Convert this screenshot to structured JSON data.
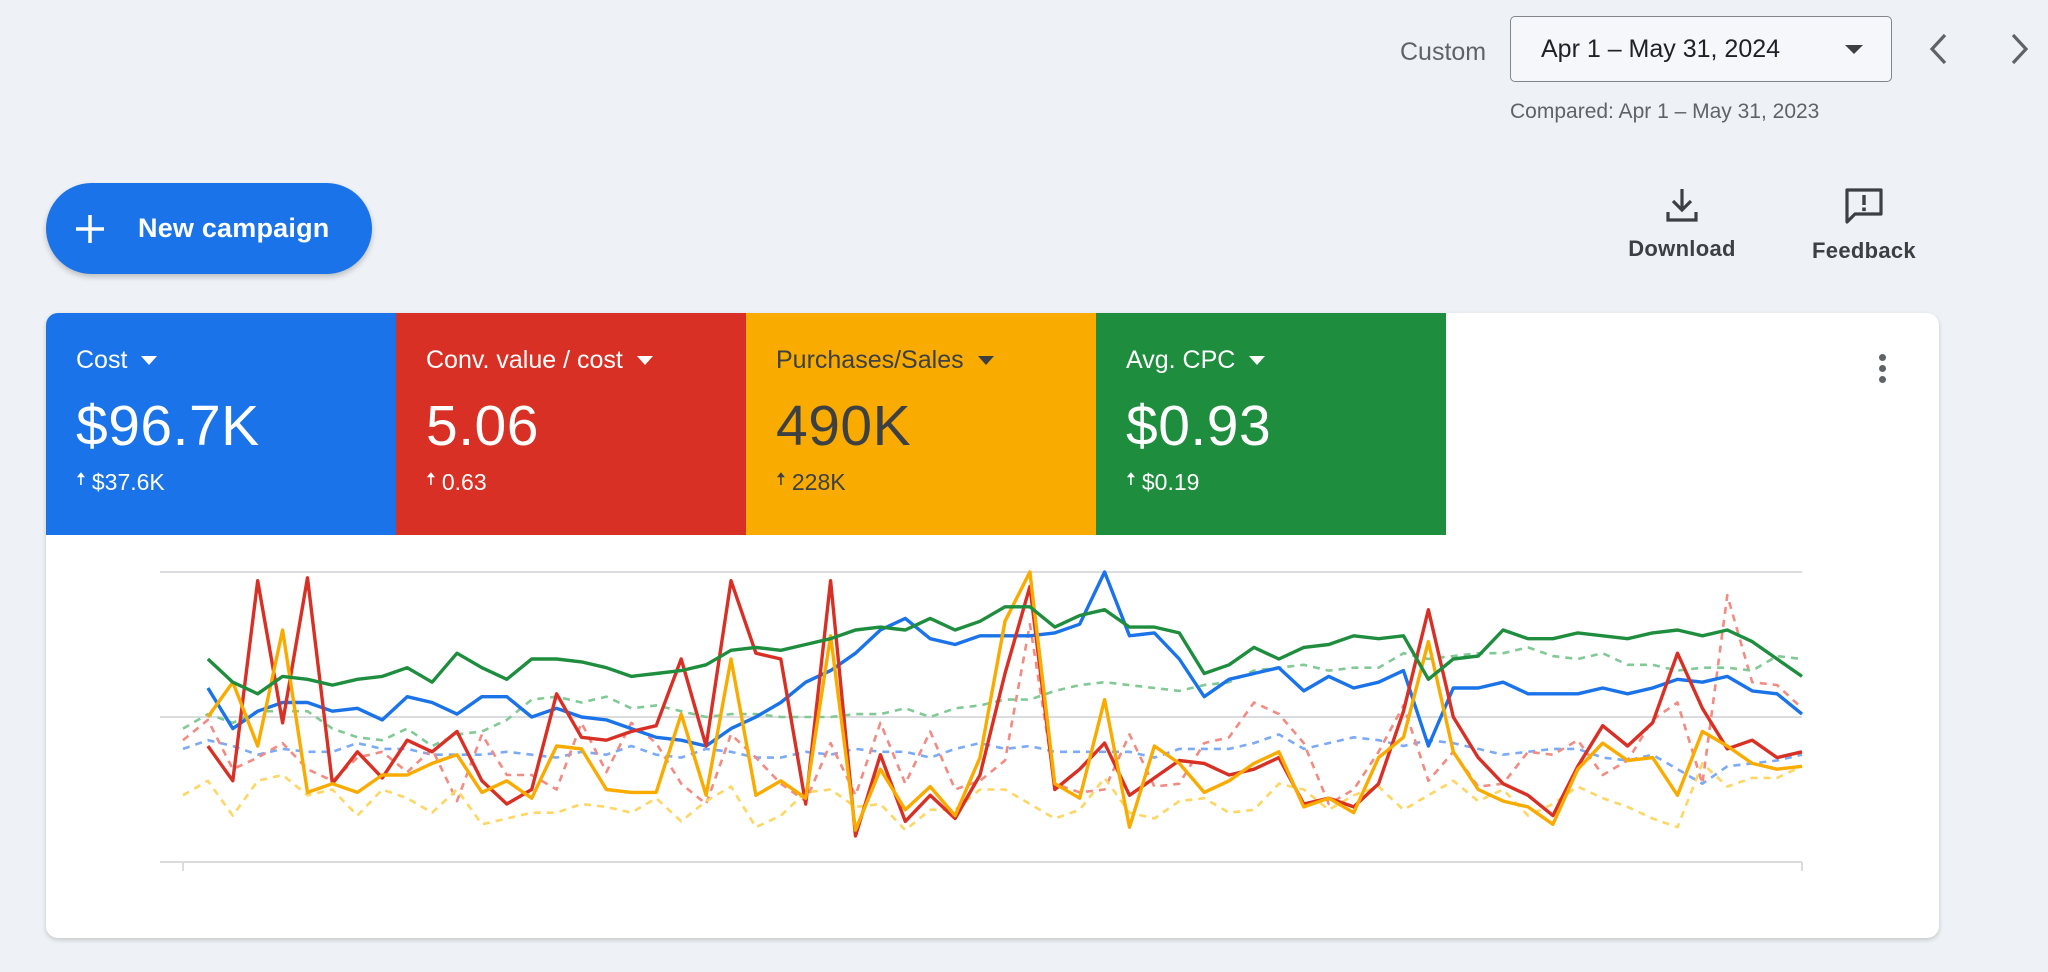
{
  "header": {
    "range_label": "Custom",
    "date_range": "Apr 1 – May 31, 2024",
    "compared": "Compared: Apr 1 – May 31, 2023"
  },
  "actions": {
    "new_campaign": "New campaign",
    "download": "Download",
    "feedback": "Feedback"
  },
  "metrics": [
    {
      "label": "Cost",
      "value": "$96.7K",
      "delta": "$37.6K",
      "color": "#1a73e8"
    },
    {
      "label": "Conv. value / cost",
      "value": "5.06",
      "delta": "0.63",
      "color": "#d93025"
    },
    {
      "label": "Purchases/Sales",
      "value": "490K",
      "delta": "228K",
      "color": "#f9ab00"
    },
    {
      "label": "Avg. CPC",
      "value": "$0.93",
      "delta": "$0.19",
      "color": "#1e8e3e"
    }
  ],
  "chart_data": {
    "type": "line",
    "x": "Apr 1 – May 31",
    "y_scale": "normalized per series (0 = bottom gridline, 100 = top gridline)",
    "series": [
      {
        "name": "Cost",
        "color": "#1a73e8",
        "style": "solid",
        "values": [
          48,
          60,
          46,
          52,
          55,
          55,
          52,
          53,
          49,
          57,
          55,
          51,
          57,
          57,
          50,
          53,
          50,
          49,
          46,
          43,
          42,
          40,
          46,
          50,
          55,
          62,
          66,
          72,
          80,
          84,
          77,
          75,
          78,
          78,
          78,
          79,
          82,
          100,
          78,
          79,
          70,
          57,
          63,
          65,
          67,
          59,
          64,
          60,
          62,
          66,
          40,
          60,
          60,
          62,
          58,
          58,
          58,
          60,
          58,
          60,
          63,
          62,
          64,
          59,
          58,
          51
        ]
      },
      {
        "name": "Conv. value / cost",
        "color": "#d93025",
        "style": "solid",
        "values": [
          27,
          40,
          28,
          97,
          48,
          98,
          27,
          38,
          29,
          42,
          38,
          45,
          28,
          20,
          25,
          58,
          43,
          42,
          45,
          47,
          70,
          40,
          97,
          72,
          70,
          20,
          97,
          9,
          37,
          14,
          23,
          15,
          30,
          65,
          95,
          25,
          32,
          41,
          23,
          29,
          35,
          34,
          30,
          32,
          36,
          20,
          22,
          19,
          27,
          52,
          87,
          50,
          36,
          27,
          23,
          16,
          33,
          47,
          40,
          48,
          72,
          53,
          39,
          42,
          36,
          38
        ]
      },
      {
        "name": "Purchases/Sales",
        "color": "#f9ab00",
        "style": "solid",
        "values": [
          28,
          50,
          62,
          40,
          80,
          24,
          27,
          24,
          30,
          30,
          34,
          37,
          24,
          28,
          22,
          40,
          39,
          25,
          24,
          24,
          51,
          23,
          70,
          23,
          28,
          22,
          78,
          11,
          32,
          18,
          26,
          16,
          36,
          83,
          100,
          27,
          22,
          56,
          12,
          40,
          34,
          24,
          28,
          34,
          38,
          19,
          22,
          17,
          36,
          43,
          76,
          38,
          25,
          21,
          19,
          13,
          32,
          41,
          35,
          36,
          23,
          45,
          40,
          34,
          32,
          33
        ]
      },
      {
        "name": "Avg. CPC",
        "color": "#1e8e3e",
        "style": "solid",
        "values": [
          64,
          70,
          62,
          58,
          64,
          63,
          61,
          63,
          64,
          67,
          62,
          72,
          67,
          63,
          70,
          70,
          69,
          67,
          64,
          65,
          66,
          68,
          73,
          74,
          73,
          75,
          77,
          80,
          81,
          80,
          84,
          80,
          83,
          88,
          88,
          81,
          85,
          87,
          81,
          81,
          79,
          65,
          68,
          74,
          70,
          74,
          75,
          78,
          77,
          78,
          63,
          70,
          71,
          80,
          77,
          77,
          79,
          78,
          77,
          79,
          80,
          78,
          80,
          76,
          70,
          64
        ]
      },
      {
        "name": "Cost (compared)",
        "color": "#7baaf7",
        "style": "dashed",
        "values": [
          39,
          42,
          40,
          37,
          39,
          38,
          38,
          41,
          39,
          39,
          37,
          37,
          37,
          38,
          37,
          36,
          38,
          37,
          40,
          37,
          36,
          39,
          38,
          36,
          36,
          38,
          37,
          39,
          38,
          38,
          36,
          39,
          41,
          39,
          40,
          38,
          38,
          38,
          38,
          36,
          39,
          39,
          39,
          41,
          44,
          39,
          41,
          43,
          42,
          40,
          42,
          41,
          39,
          37,
          38,
          39,
          39,
          36,
          35,
          37,
          32,
          27,
          33,
          34,
          35,
          37
        ]
      },
      {
        "name": "Conv. value / cost (compared)",
        "color": "#f28b82",
        "style": "dashed",
        "values": [
          42,
          49,
          32,
          36,
          41,
          32,
          28,
          36,
          38,
          31,
          39,
          21,
          44,
          30,
          30,
          25,
          48,
          31,
          48,
          41,
          27,
          20,
          44,
          36,
          27,
          21,
          41,
          23,
          48,
          27,
          45,
          25,
          28,
          35,
          82,
          27,
          24,
          25,
          44,
          26,
          27,
          41,
          43,
          55,
          51,
          41,
          20,
          25,
          38,
          54,
          28,
          38,
          26,
          27,
          38,
          37,
          42,
          30,
          35,
          49,
          55,
          27,
          92,
          62,
          61,
          53
        ]
      },
      {
        "name": "Purchases/Sales (compared)",
        "color": "#fdd663",
        "style": "dashed",
        "values": [
          23,
          28,
          16,
          28,
          30,
          23,
          25,
          16,
          25,
          22,
          17,
          25,
          13,
          15,
          17,
          17,
          20,
          19,
          17,
          22,
          14,
          21,
          26,
          12,
          16,
          24,
          25,
          19,
          20,
          11,
          18,
          18,
          25,
          25,
          20,
          15,
          18,
          29,
          17,
          15,
          21,
          22,
          17,
          18,
          27,
          25,
          18,
          23,
          26,
          18,
          23,
          28,
          21,
          25,
          16,
          20,
          26,
          22,
          19,
          15,
          12,
          34,
          26,
          29,
          29,
          33
        ]
      },
      {
        "name": "Avg. CPC (compared)",
        "color": "#81c995",
        "style": "dashed",
        "values": [
          46,
          51,
          48,
          52,
          52,
          52,
          46,
          43,
          42,
          46,
          40,
          44,
          45,
          49,
          56,
          57,
          55,
          57,
          53,
          54,
          52,
          50,
          51,
          51,
          50,
          50,
          50,
          51,
          51,
          53,
          50,
          53,
          54,
          56,
          56,
          59,
          61,
          62,
          61,
          60,
          59,
          61,
          62,
          66,
          67,
          68,
          66,
          67,
          67,
          72,
          70,
          71,
          72,
          72,
          74,
          71,
          70,
          72,
          68,
          68,
          66,
          67,
          67,
          66,
          71,
          70
        ]
      }
    ]
  }
}
